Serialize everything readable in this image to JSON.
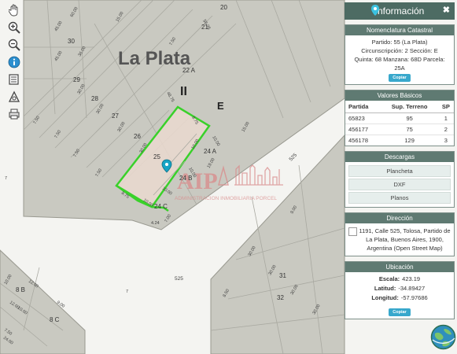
{
  "map": {
    "title": "La Plata",
    "roman": "II",
    "sector_letter": "E",
    "watermark_brand": "AIP",
    "watermark_text": "ADMINISTRACION INMOBILIARIA PORCEL",
    "parcel_labels": [
      "20",
      "21",
      "22 A",
      "29",
      "28",
      "27",
      "26",
      "25",
      "24 A",
      "24 B",
      "24 C",
      "30",
      "31",
      "32",
      "8 B",
      "8 C"
    ],
    "dimension_labels": [
      "60.00",
      "56.25",
      "45.00",
      "45.00",
      "36.00",
      "30.00",
      "15.00",
      "7.50",
      "7.50",
      "7.50",
      "7.50",
      "7.50",
      "48.75",
      "8.75",
      "8.75",
      "30.00",
      "30.00",
      "30.00",
      "10.00",
      "10.00",
      "10.00",
      "19.00",
      "15.00",
      "10.00",
      "10.00",
      "4.24",
      "7.00",
      "9.00",
      "8.50",
      "30.00",
      "30.00",
      "30.00",
      "30.00",
      "12.00",
      "10.00",
      "10.00",
      "12.00",
      "9.00",
      "7.50",
      "24.00",
      "525",
      "525",
      "7",
      "7"
    ]
  },
  "toolbar": {
    "icons": [
      "pan-hand-icon",
      "zoom-in-icon",
      "zoom-out-icon",
      "info-icon",
      "layers-icon",
      "measure-icon",
      "print-icon"
    ]
  },
  "panel": {
    "title": "Información",
    "close": "✖",
    "nomenclatura": {
      "heading": "Nomenclatura Catastral",
      "lines": [
        "Partido: 55 (La Plata)",
        "Circunscripción: 2 Sección: E",
        "Quinta: 68 Manzana: 68D Parcela:",
        "25A"
      ],
      "copy": "Copiar"
    },
    "valores": {
      "heading": "Valores Básicos",
      "columns": [
        "Partida",
        "Sup. Terreno",
        "SP"
      ],
      "rows": [
        [
          "65823",
          "95",
          "1"
        ],
        [
          "456177",
          "75",
          "2"
        ],
        [
          "456178",
          "129",
          "3"
        ]
      ]
    },
    "descargas": {
      "heading": "Descargas",
      "items": [
        "Plancheta",
        "DXF",
        "Planos"
      ]
    },
    "direccion": {
      "heading": "Dirección",
      "text": "1191, Calle 525, Tolosa, Partido de La Plata, Buenos Aires, 1900, Argentina (Open Street Map)"
    },
    "ubicacion": {
      "heading": "Ubicación",
      "escala_label": "Escala:",
      "escala": "423.19",
      "latitud_label": "Latitud:",
      "latitud": "-34.89427",
      "longitud_label": "Longitud:",
      "longitud": "-57.97686",
      "copy": "Copiar"
    }
  },
  "colors": {
    "block": "#c9c9c1",
    "block_stroke": "#999990",
    "street": "#f4f4f1",
    "selected_fill": "#ead9cf",
    "selected_stroke": "#39d12a",
    "panel_header": "#4d6b63",
    "accent_button": "#38a8cc",
    "watermark": "#d98b8b"
  }
}
